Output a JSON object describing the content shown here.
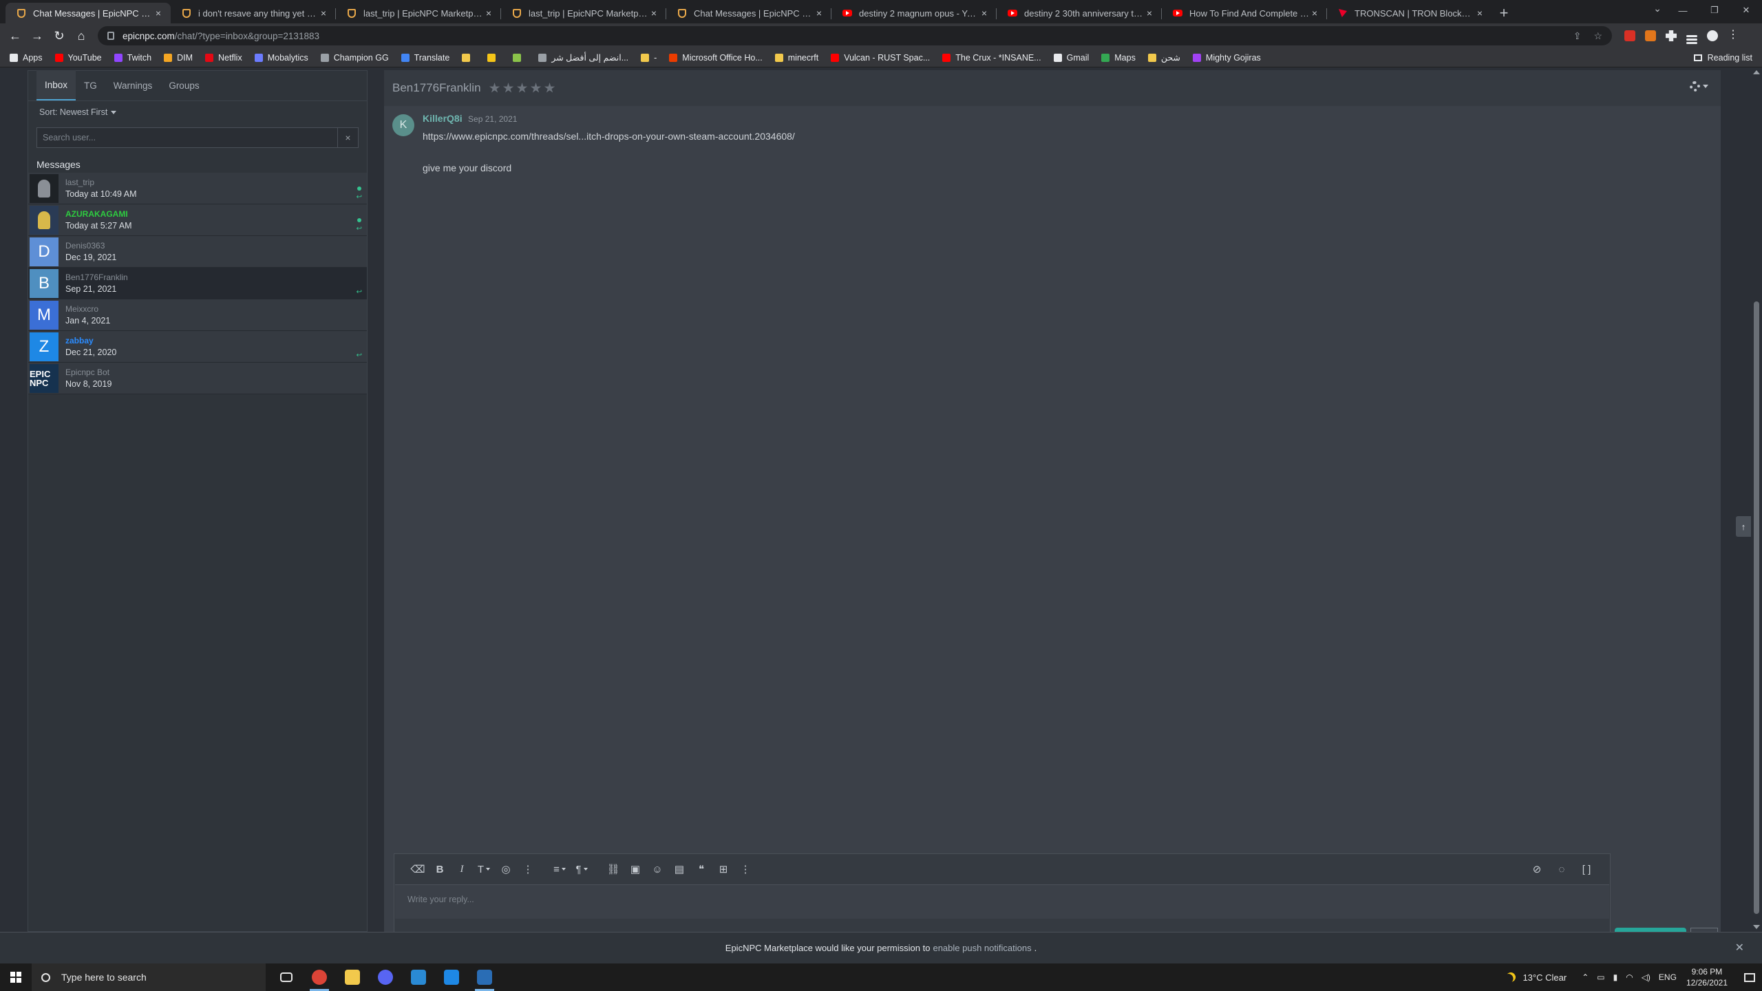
{
  "browser": {
    "tabs": [
      {
        "title": "Chat Messages | EpicNPC Marketplace",
        "icon": "shield",
        "active": true
      },
      {
        "title": "i don't resave any thing yet form...",
        "icon": "shield"
      },
      {
        "title": "last_trip | EpicNPC Marketplace",
        "icon": "shield"
      },
      {
        "title": "last_trip | EpicNPC Marketplace",
        "icon": "shield"
      },
      {
        "title": "Chat Messages | EpicNPC Marketplace",
        "icon": "shield"
      },
      {
        "title": "destiny 2 magnum opus - YouTube",
        "icon": "youtube"
      },
      {
        "title": "destiny 2 30th anniversary triumphs",
        "icon": "youtube"
      },
      {
        "title": "How To Find And Complete 30th...",
        "icon": "youtube"
      },
      {
        "title": "TRONSCAN | TRON BlockChain E...",
        "icon": "tron"
      }
    ],
    "url_host": "epicnpc.com",
    "url_rest": "/chat/?type=inbox&group=2131883",
    "bookmarks": [
      {
        "label": "Apps",
        "color": "#e8eaed"
      },
      {
        "label": "YouTube",
        "color": "#ff0000"
      },
      {
        "label": "Twitch",
        "color": "#9146ff"
      },
      {
        "label": "DIM",
        "color": "#f5a623"
      },
      {
        "label": "Netflix",
        "color": "#e50914"
      },
      {
        "label": "Mobalytics",
        "color": "#6c7cff"
      },
      {
        "label": "Champion GG",
        "color": "#9aa0a6"
      },
      {
        "label": "Translate",
        "color": "#4285f4"
      },
      {
        "label": "",
        "color": "#f2c94c"
      },
      {
        "label": "",
        "color": "#f5c518"
      },
      {
        "label": "",
        "color": "#8bc34a"
      },
      {
        "label": "انضم إلى أفضل شر...",
        "color": "#9aa0a6"
      },
      {
        "label": "-",
        "color": "#f2c94c"
      },
      {
        "label": "Microsoft Office Ho...",
        "color": "#eb3c00"
      },
      {
        "label": "minecrft",
        "color": "#f2c94c"
      },
      {
        "label": "Vulcan - RUST Spac...",
        "color": "#ff0000"
      },
      {
        "label": "The Crux - *INSANE...",
        "color": "#ff0000"
      },
      {
        "label": "Gmail",
        "color": "#e8eaed"
      },
      {
        "label": "Maps",
        "color": "#34a853"
      },
      {
        "label": "شحن",
        "color": "#f2c94c"
      },
      {
        "label": "Mighty Gojiras",
        "color": "#a142f4"
      }
    ],
    "reading_list": "Reading list"
  },
  "sidebar": {
    "tabs": [
      "Inbox",
      "TG",
      "Warnings",
      "Groups"
    ],
    "sort_label": "Sort: Newest First",
    "search_placeholder": "Search user...",
    "clear": "×",
    "heading": "Messages",
    "conversations": [
      {
        "name": "last_trip",
        "date": "Today at 10:49 AM",
        "avatar_letter": "",
        "avatar_color": "#1e2226",
        "style": "",
        "online": true,
        "replied": true
      },
      {
        "name": "AZURAKAGAMI",
        "date": "Today at 5:27 AM",
        "avatar_letter": "",
        "avatar_color": "#2a3b55",
        "style": "green",
        "online": true,
        "replied": true
      },
      {
        "name": "Denis0363",
        "date": "Dec 19, 2021",
        "avatar_letter": "D",
        "avatar_color": "#5e8fd6",
        "style": "",
        "online": false,
        "replied": false
      },
      {
        "name": "Ben1776Franklin",
        "date": "Sep 21, 2021",
        "avatar_letter": "B",
        "avatar_color": "#4f8fc0",
        "style": "",
        "online": false,
        "replied": true,
        "selected": true
      },
      {
        "name": "Meixxcro",
        "date": "Jan 4, 2021",
        "avatar_letter": "M",
        "avatar_color": "#3b6fd6",
        "style": "",
        "online": false,
        "replied": false
      },
      {
        "name": "zabbay",
        "date": "Dec 21, 2020",
        "avatar_letter": "Z",
        "avatar_color": "#1e88e5",
        "style": "blue",
        "online": false,
        "replied": true
      },
      {
        "name": "Epicnpc Bot",
        "date": "Nov 8, 2019",
        "avatar_letter": "EPIC NPC",
        "avatar_color": "#16324f",
        "style": "",
        "online": false,
        "replied": false
      }
    ]
  },
  "chat": {
    "title": "Ben1776Franklin",
    "stars": 5,
    "message": {
      "avatar_letter": "K",
      "author": "KillerQ8i",
      "date": "Sep 21, 2021",
      "link": "https://www.epicnpc.com/threads/sel...itch-drops-on-your-own-steam-account.2034608/",
      "text": "give me your discord"
    },
    "reply_placeholder": "Write your reply..."
  },
  "notice": {
    "prefix": "EpicNPC Marketplace would like your permission to",
    "link": "enable push notifications",
    "suffix": "."
  },
  "taskbar": {
    "search_placeholder": "Type here to search",
    "apps": [
      {
        "name": "task-view",
        "color": "#e5e5e5",
        "active": false
      },
      {
        "name": "chrome",
        "color": "#db4437",
        "active": true
      },
      {
        "name": "file-explorer",
        "color": "#f2c94c",
        "active": false
      },
      {
        "name": "discord",
        "color": "#5865f2",
        "active": false
      },
      {
        "name": "mail",
        "color": "#2a8ad4",
        "active": false
      },
      {
        "name": "app-blue",
        "color": "#1e88e5",
        "active": false
      },
      {
        "name": "steam",
        "color": "#2a6db5",
        "active": true
      }
    ],
    "weather": "13°C  Clear",
    "language": "ENG",
    "time": "9:06 PM",
    "date": "12/26/2021"
  }
}
